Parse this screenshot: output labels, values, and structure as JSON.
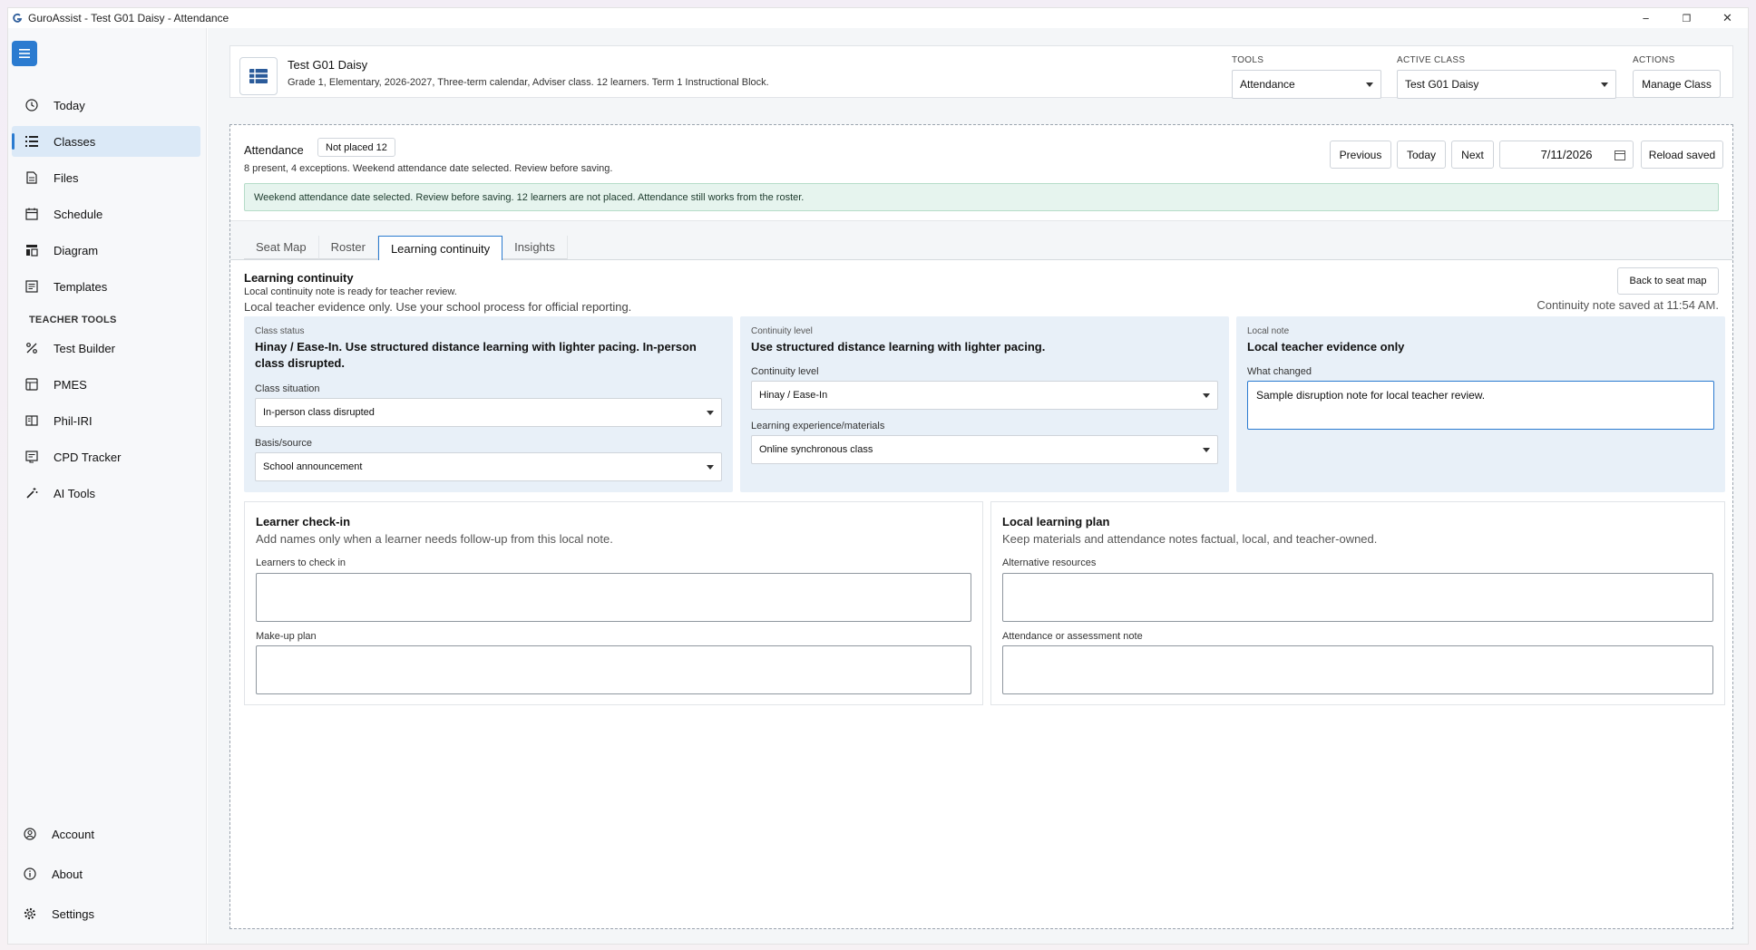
{
  "window": {
    "title": "GuroAssist - Test G01 Daisy - Attendance",
    "minimize": "−",
    "restore": "❐",
    "close": "✕"
  },
  "sidebar": {
    "items": [
      {
        "label": "Today",
        "icon": "clock-icon"
      },
      {
        "label": "Classes",
        "icon": "list-icon",
        "active": true
      },
      {
        "label": "Files",
        "icon": "file-icon"
      },
      {
        "label": "Schedule",
        "icon": "calendar-icon"
      },
      {
        "label": "Diagram",
        "icon": "diagram-icon"
      },
      {
        "label": "Templates",
        "icon": "template-icon"
      }
    ],
    "section_label": "TEACHER TOOLS",
    "tools": [
      {
        "label": "Test Builder",
        "icon": "percent-icon"
      },
      {
        "label": "PMES",
        "icon": "pmes-icon"
      },
      {
        "label": "Phil-IRI",
        "icon": "book-icon"
      },
      {
        "label": "CPD Tracker",
        "icon": "tracker-icon"
      },
      {
        "label": "AI Tools",
        "icon": "wand-icon"
      }
    ],
    "bottom": [
      {
        "label": "Account",
        "icon": "account-icon"
      },
      {
        "label": "About",
        "icon": "info-icon"
      },
      {
        "label": "Settings",
        "icon": "gear-icon"
      }
    ]
  },
  "header": {
    "class_name": "Test G01 Daisy",
    "class_meta": "Grade 1, Elementary, 2026-2027, Three-term calendar, Adviser class. 12 learners. Term 1 Instructional Block.",
    "tools_label": "TOOLS",
    "tools_value": "Attendance",
    "active_class_label": "ACTIVE CLASS",
    "active_class_value": "Test G01 Daisy",
    "actions_label": "ACTIONS",
    "manage_class": "Manage Class"
  },
  "attendance": {
    "title": "Attendance",
    "badge": "Not placed 12",
    "summary": "8 present, 4 exceptions. Weekend attendance date selected. Review before saving.",
    "previous": "Previous",
    "today": "Today",
    "next": "Next",
    "date": "7/11/2026",
    "reload": "Reload saved",
    "alert": "Weekend attendance date selected. Review before saving. 12 learners are not placed. Attendance still works from the roster."
  },
  "tabs": [
    "Seat Map",
    "Roster",
    "Learning continuity",
    "Insights"
  ],
  "continuity": {
    "title": "Learning continuity",
    "status_line": "Local continuity note is ready for teacher review.",
    "evidence_line": "Local teacher evidence only. Use your school process for official reporting.",
    "back_button": "Back to seat map",
    "saved_note": "Continuity note saved at 11:54 AM.",
    "class_status": {
      "key": "Class status",
      "value": "Hinay / Ease-In. Use structured distance learning with lighter pacing. In-person class disrupted.",
      "situation_label": "Class situation",
      "situation_value": "In-person class disrupted",
      "basis_label": "Basis/source",
      "basis_value": "School announcement"
    },
    "continuity_level": {
      "key": "Continuity level",
      "value": "Use structured distance learning with lighter pacing.",
      "level_label": "Continuity level",
      "level_value": "Hinay / Ease-In",
      "materials_label": "Learning experience/materials",
      "materials_value": "Online synchronous class"
    },
    "local_note": {
      "key": "Local note",
      "value": "Local teacher evidence only",
      "changed_label": "What changed",
      "changed_value": "Sample disruption note for local teacher review."
    },
    "checkin": {
      "title": "Learner check-in",
      "subtitle": "Add names only when a learner needs follow-up from this local note.",
      "learners_label": "Learners to check in",
      "learners_value": "",
      "makeup_label": "Make-up plan",
      "makeup_value": ""
    },
    "plan": {
      "title": "Local learning plan",
      "subtitle": "Keep materials and attendance notes factual, local, and teacher-owned.",
      "resources_label": "Alternative resources",
      "resources_value": "",
      "note_label": "Attendance or assessment note",
      "note_value": ""
    }
  },
  "colors": {
    "accent": "#2b7bd0",
    "active_nav": "#dbe9f7",
    "alert_bg": "#e6f4ee",
    "card_bg": "#e8f0f8"
  }
}
